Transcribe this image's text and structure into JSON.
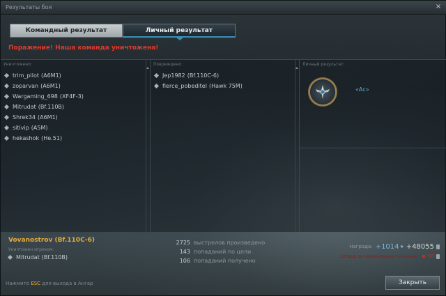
{
  "window": {
    "title": "Результаты боя",
    "close": "×"
  },
  "tabs": [
    {
      "label": "Командный результат",
      "active": false
    },
    {
      "label": "Личный результат",
      "active": true
    }
  ],
  "result_message": "Поражение! Наша команда уничтожена!",
  "panels": {
    "destroyed": {
      "label": "Уничтожено:",
      "items": [
        {
          "player": "trim_pilot",
          "aircraft": "(A6M1)"
        },
        {
          "player": "zoparvan",
          "aircraft": "(A6M1)"
        },
        {
          "player": "Wargaming_698",
          "aircraft": "(XF4F-3)"
        },
        {
          "player": "Mitrudat",
          "aircraft": "(Bf.110B)"
        },
        {
          "player": "Shrek34",
          "aircraft": "(A6M1)"
        },
        {
          "player": "sitivip",
          "aircraft": "(A5M)"
        },
        {
          "player": "hekashok",
          "aircraft": "(He.51)"
        }
      ]
    },
    "damaged": {
      "label": "Повреждено:",
      "items": [
        {
          "player": "Jep1982",
          "aircraft": "(Bf.110C-6)"
        },
        {
          "player": "fierce_pobeditel",
          "aircraft": "(Hawk 75M)"
        }
      ]
    },
    "personal": {
      "label": "Личный результат:",
      "medal_name": "«Ас»"
    }
  },
  "footer": {
    "self": "Vovanostrov (Bf.110C-6)",
    "killed_by_label": "Уничтожен игроком:",
    "killer": {
      "player": "Mitrudat",
      "aircraft": "(Bf.110B)"
    },
    "stats": [
      {
        "value": "2725",
        "label": "выстрелов произведено"
      },
      {
        "value": "143",
        "label": "попаданий по цели"
      },
      {
        "value": "106",
        "label": "попаданий получено"
      }
    ],
    "reward_label": "Награда:",
    "xp": "+1014",
    "credits": "+48055",
    "penalty_label": "Штраф за повреждение союзника:",
    "penalty": "-56",
    "esc_prefix": "Нажмите ",
    "esc_key": "ESC",
    "esc_suffix": " для выхода в Ангар",
    "close_button": "Закрыть"
  },
  "colors": {
    "defeat": "#e03a2c",
    "self_name": "#e5a93a",
    "xp": "#76b6dd",
    "tab_accent": "#3c8fb8"
  }
}
